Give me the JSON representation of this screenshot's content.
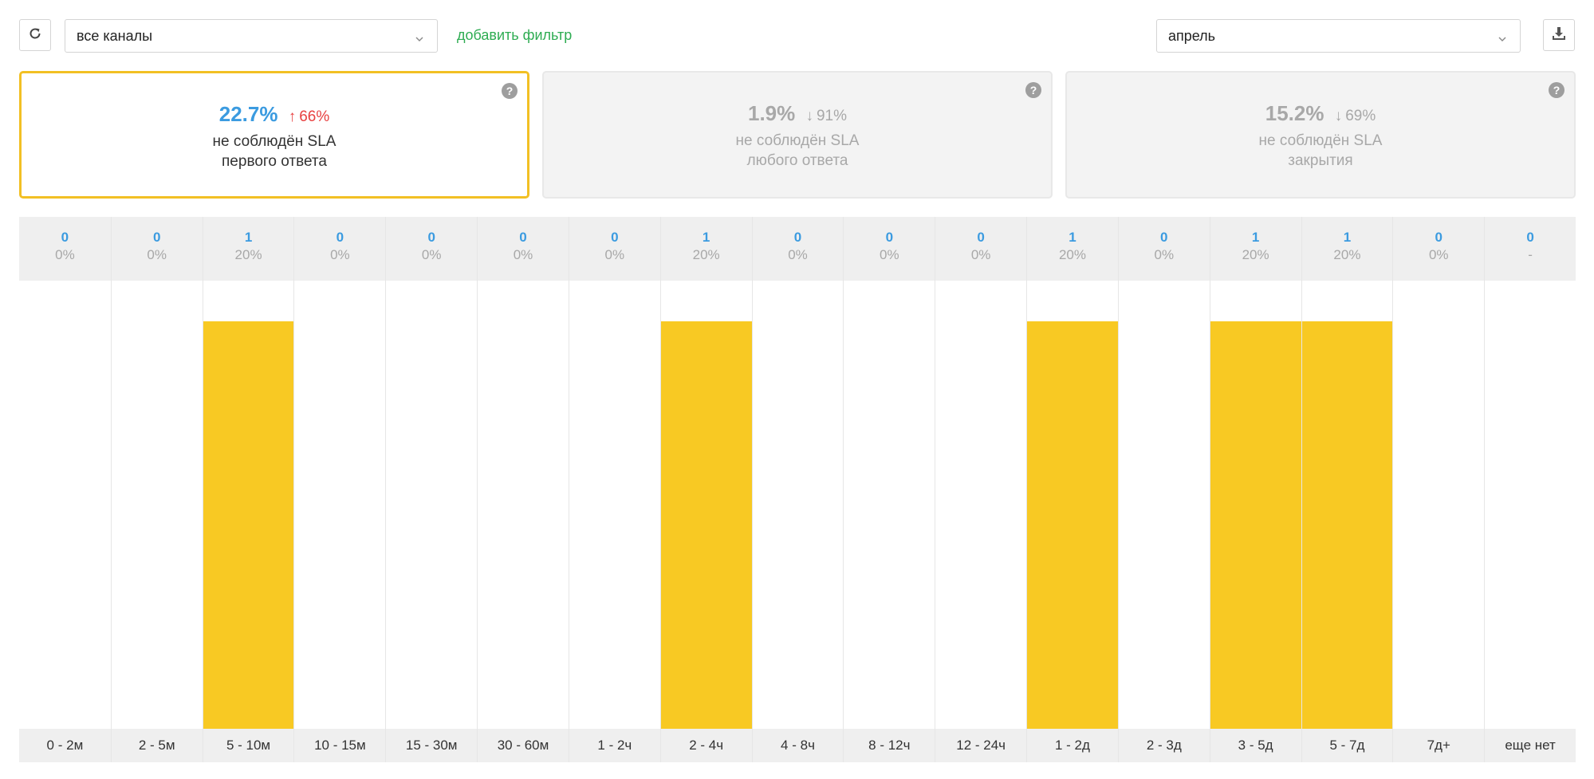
{
  "toolbar": {
    "refresh_icon": "refresh-icon",
    "channel_select": {
      "value": "все каналы"
    },
    "add_filter_label": "добавить фильтр",
    "period_select": {
      "value": "апрель"
    },
    "download_icon": "download-icon"
  },
  "cards": [
    {
      "value": "22.7%",
      "trend_direction": "up",
      "trend_value": "66%",
      "line1": "не соблюдён SLA",
      "line2": "первого ответа",
      "active": true
    },
    {
      "value": "1.9%",
      "trend_direction": "down",
      "trend_value": "91%",
      "line1": "не соблюдён SLA",
      "line2": "любого ответа",
      "active": false
    },
    {
      "value": "15.2%",
      "trend_direction": "down",
      "trend_value": "69%",
      "line1": "не соблюдён SLA",
      "line2": "закрытия",
      "active": false
    }
  ],
  "colors": {
    "bar": "#f8c923",
    "count": "#3b9be0",
    "trend_up": "#e84040",
    "active_border": "#f2c024",
    "add_filter": "#2eac52"
  },
  "chart_data": {
    "type": "bar",
    "categories": [
      "0 - 2м",
      "2 - 5м",
      "5 - 10м",
      "10 - 15м",
      "15 - 30м",
      "30 - 60м",
      "1 - 2ч",
      "2 - 4ч",
      "4 - 8ч",
      "8 - 12ч",
      "12 - 24ч",
      "1 - 2д",
      "2 - 3д",
      "3 - 5д",
      "5 - 7д",
      "7д+",
      "еще нет"
    ],
    "values": [
      0,
      0,
      1,
      0,
      0,
      0,
      0,
      1,
      0,
      0,
      0,
      1,
      0,
      1,
      1,
      0,
      0
    ],
    "percent_labels": [
      "0%",
      "0%",
      "20%",
      "0%",
      "0%",
      "0%",
      "0%",
      "20%",
      "0%",
      "0%",
      "0%",
      "20%",
      "0%",
      "20%",
      "20%",
      "0%",
      "-"
    ],
    "ylim": [
      0,
      1.1
    ],
    "grid": false,
    "legend": "none"
  }
}
